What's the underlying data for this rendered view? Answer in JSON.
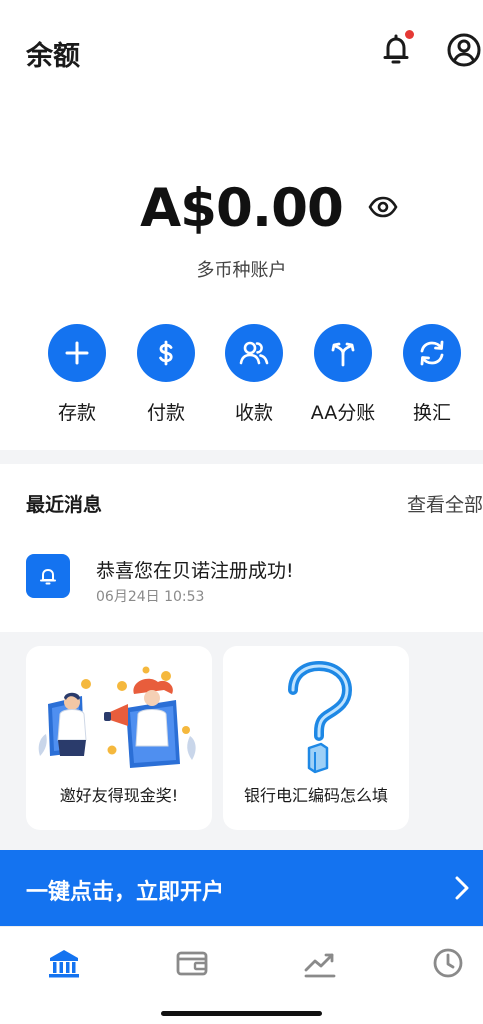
{
  "header": {
    "title": "余额",
    "notification_icon": "bell-icon",
    "profile_icon": "user-circle-icon",
    "has_unread": true
  },
  "balance": {
    "amount": "A$0.00",
    "visibility_icon": "eye-icon",
    "account_type": "多币种账户"
  },
  "actions": [
    {
      "label": "存款",
      "icon": "plus-icon"
    },
    {
      "label": "付款",
      "icon": "dollar-icon"
    },
    {
      "label": "收款",
      "icon": "users-icon"
    },
    {
      "label": "AA分账",
      "icon": "split-icon"
    },
    {
      "label": "换汇",
      "icon": "exchange-icon"
    }
  ],
  "messages": {
    "header": "最近消息",
    "view_all": "查看全部",
    "items": [
      {
        "title": "恭喜您在贝诺注册成功!",
        "time": "06月24日 10:53",
        "icon": "bell-icon"
      }
    ]
  },
  "promo_cards": [
    {
      "caption": "邀好友得现金奖!",
      "illustration": "referral-illustration"
    },
    {
      "caption": "银行电汇编码怎么填",
      "illustration": "question-mark-illustration"
    }
  ],
  "cta": {
    "label": "一键点击，立即开户",
    "icon": "chevron-right-icon"
  },
  "tabbar": {
    "tabs": [
      {
        "name": "home",
        "icon": "bank-icon",
        "active": true
      },
      {
        "name": "wallet",
        "icon": "wallet-icon",
        "active": false
      },
      {
        "name": "markets",
        "icon": "chart-line-icon",
        "active": false
      },
      {
        "name": "history",
        "icon": "clock-icon",
        "active": false
      }
    ]
  },
  "colors": {
    "accent": "#1473f0",
    "notification_dot": "#e53935",
    "inactive_tab": "#8a8a8a"
  }
}
